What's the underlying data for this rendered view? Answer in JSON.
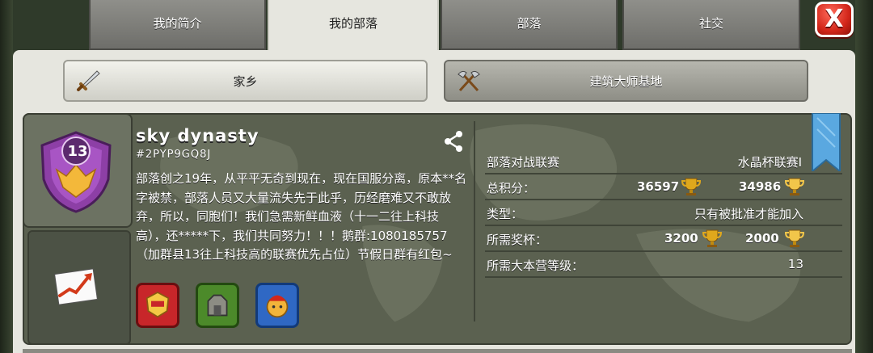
{
  "tabs": [
    {
      "label": "我的简介"
    },
    {
      "label": "我的部落"
    },
    {
      "label": "部落"
    },
    {
      "label": "社交"
    }
  ],
  "close_button": {
    "label": "X"
  },
  "subtabs": {
    "home": {
      "label": "家乡",
      "icon": "sword-icon"
    },
    "builder": {
      "label": "建筑大师基地",
      "icon": "crossed-axes-icon"
    }
  },
  "clan": {
    "name": "sky dynasty",
    "tag": "#2PYP9GQ8J",
    "level": "13",
    "description": "部落创之19年，从平平无奇到现在，现在国服分离，原本**名字被禁，部落人员又大量流失先于此乎，历经磨难又不敢放弃，所以，同胞们！我们急需新鲜血液（十一二往上科技高），还*****下，我们共同努力！！！鹅群:1080185757（加群县13往上科技高的联赛优先占位）节假日群有红包~"
  },
  "info": {
    "war_league": {
      "label": "部落对战联赛",
      "value": "水晶杯联赛I"
    },
    "total_points": {
      "label": "总积分：",
      "home_value": "36597",
      "builder_value": "34986"
    },
    "type": {
      "label": "类型：",
      "value": "只有被批准才能加入"
    },
    "required_trophies": {
      "label": "所需奖杯：",
      "home_value": "3200",
      "builder_value": "2000"
    },
    "required_th": {
      "label": "所需大本营等级：",
      "value": "13"
    }
  },
  "colors": {
    "trophy_gold": "#e0a81c",
    "trophy_silver_gold": "#f2c64a",
    "ribbon_blue": "#5aa8e0",
    "badge_purple": "#8d3fa6"
  }
}
